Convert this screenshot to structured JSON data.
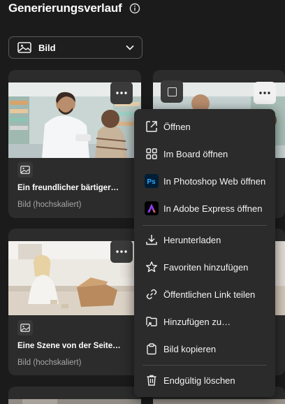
{
  "header": {
    "title": "Generierungsverlauf",
    "info_icon": "info-icon"
  },
  "filter": {
    "value": "Bild",
    "icon": "image-icon",
    "chevron": "chevron-down-icon"
  },
  "cards": [
    {
      "caption": "Ein freundlicher bärtiger…",
      "subtitle": "Bild (hochskaliert)"
    },
    {
      "caption": "Eine Szene von der Seite…",
      "subtitle": "Bild (hochskaliert)"
    }
  ],
  "context_menu": {
    "items": [
      {
        "label": "Öffnen",
        "icon": "open-external-icon"
      },
      {
        "label": "Im Board öffnen",
        "icon": "board-icon"
      },
      {
        "label": "In Photoshop Web öffnen",
        "icon": "photoshop-icon"
      },
      {
        "label": "In Adobe Express öffnen",
        "icon": "adobe-express-icon"
      },
      {
        "label": "Herunterladen",
        "icon": "download-icon"
      },
      {
        "label": "Favoriten hinzufügen",
        "icon": "star-icon"
      },
      {
        "label": "Öffentlichen Link teilen",
        "icon": "link-icon"
      },
      {
        "label": "Hinzufügen zu…",
        "icon": "add-to-folder-icon"
      },
      {
        "label": "Bild kopieren",
        "icon": "copy-image-icon"
      },
      {
        "label": "Endgültig löschen",
        "icon": "trash-icon"
      }
    ],
    "ps_badge": "Ps"
  },
  "colors": {
    "background": "#1b1b1b",
    "card": "#2c2c2c",
    "menu": "#2b2b2b",
    "muted_text": "#a6a6a6"
  }
}
